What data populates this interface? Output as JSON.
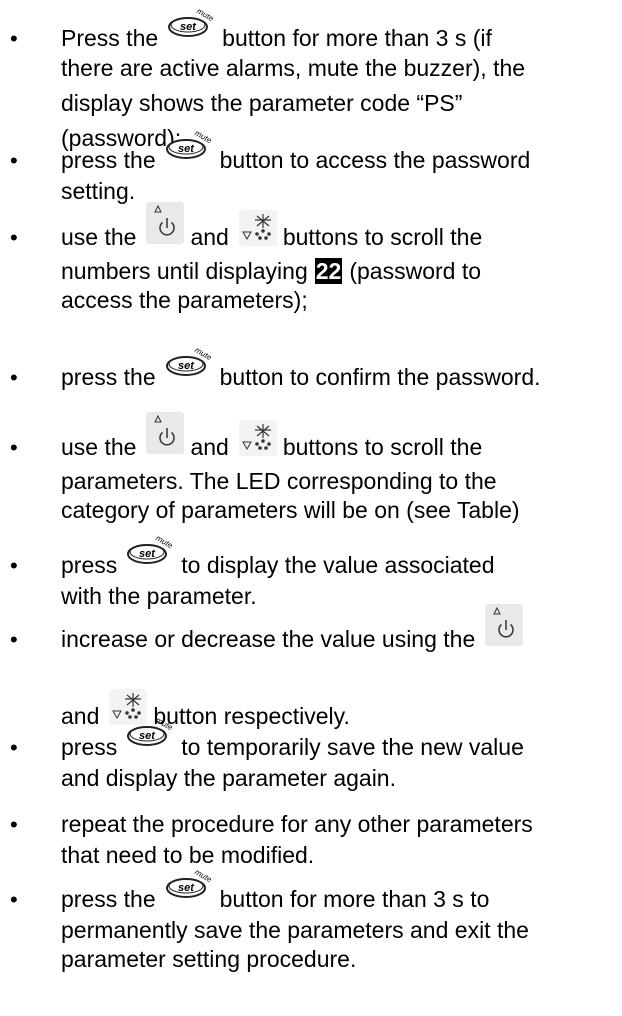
{
  "instructions": [
    {
      "lines": [
        [
          "Press the",
          {
            "icon": "set-mute-button-icon"
          },
          "button for more than 3 s (if"
        ],
        [
          "there are active alarms, mute the buzzer), the"
        ],
        [
          "display shows the parameter code “PS”"
        ],
        [
          "(password);"
        ]
      ]
    },
    {
      "lines": [
        [
          "press the",
          {
            "icon": "set-mute-button-icon"
          },
          "button to access the password"
        ],
        [
          "setting."
        ]
      ]
    },
    {
      "lines": [
        [
          "use the",
          {
            "icon": "up-power-button-icon"
          },
          "and",
          {
            "icon": "down-defrost-button-icon"
          },
          "buttons to scroll the"
        ],
        [
          "numbers until displaying",
          {
            "highlight": "22"
          },
          "(password to"
        ],
        [
          "access the parameters);"
        ]
      ]
    },
    {
      "lines": [
        [
          "press the",
          {
            "icon": "set-mute-button-icon"
          },
          "button to confirm the password."
        ]
      ]
    },
    {
      "lines": [
        [
          "use the",
          {
            "icon": "up-power-button-icon"
          },
          "and",
          {
            "icon": "down-defrost-button-icon"
          },
          "buttons to scroll the"
        ],
        [
          "parameters. The LED corresponding to the"
        ],
        [
          "category of parameters will be on (see Table)"
        ]
      ]
    },
    {
      "lines": [
        [
          "press",
          {
            "icon": "set-mute-button-icon"
          },
          "to display the value associated"
        ],
        [
          "with the parameter."
        ]
      ]
    },
    {
      "lines": [
        [
          "increase or decrease the value using the",
          {
            "icon": "up-power-button-icon"
          }
        ],
        [
          "and",
          {
            "icon": "down-defrost-button-icon"
          },
          "button respectively."
        ]
      ]
    },
    {
      "lines": [
        [
          "press",
          {
            "icon": "set-mute-button-icon"
          },
          "to temporarily save the new value"
        ],
        [
          "and display the parameter again."
        ]
      ]
    },
    {
      "lines": [
        [
          "repeat the procedure for any other parameters"
        ],
        [
          "that need to be modified."
        ]
      ]
    },
    {
      "lines": [
        [
          "press the",
          {
            "icon": "set-mute-button-icon"
          },
          "button for more than 3 s to"
        ],
        [
          "permanently save the parameters and exit the"
        ],
        [
          "parameter setting procedure."
        ]
      ]
    }
  ],
  "icon_labels": {
    "set": "set",
    "mute": "mute"
  },
  "colors": {
    "text": "#000000",
    "highlight_bg": "#000000",
    "highlight_fg": "#ffffff",
    "icon_outline": "#222222",
    "up_icon_bg": "#e9e9e9"
  }
}
